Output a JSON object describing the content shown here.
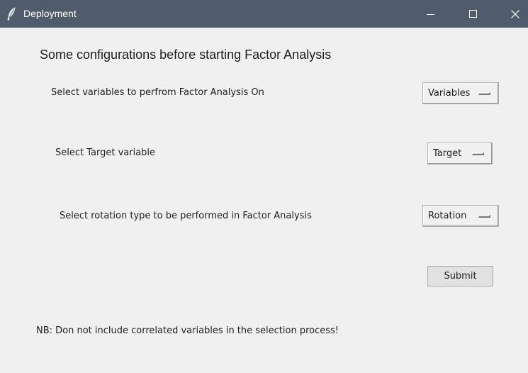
{
  "window": {
    "title": "Deployment",
    "titlebar_color": "#505c6b",
    "background_color": "#f0f0f0",
    "app_icon": "feather-icon"
  },
  "main": {
    "heading": "Some configurations before starting Factor Analysis",
    "rows": [
      {
        "label": "Select variables to perfrom Factor Analysis On",
        "menu_value": "Variables"
      },
      {
        "label": "Select Target variable",
        "menu_value": "Target"
      },
      {
        "label": "Select rotation type to be performed in Factor Analysis",
        "menu_value": "Rotation"
      }
    ],
    "submit_label": "Submit",
    "note": "NB: Don not include correlated variables in the selection process!"
  }
}
